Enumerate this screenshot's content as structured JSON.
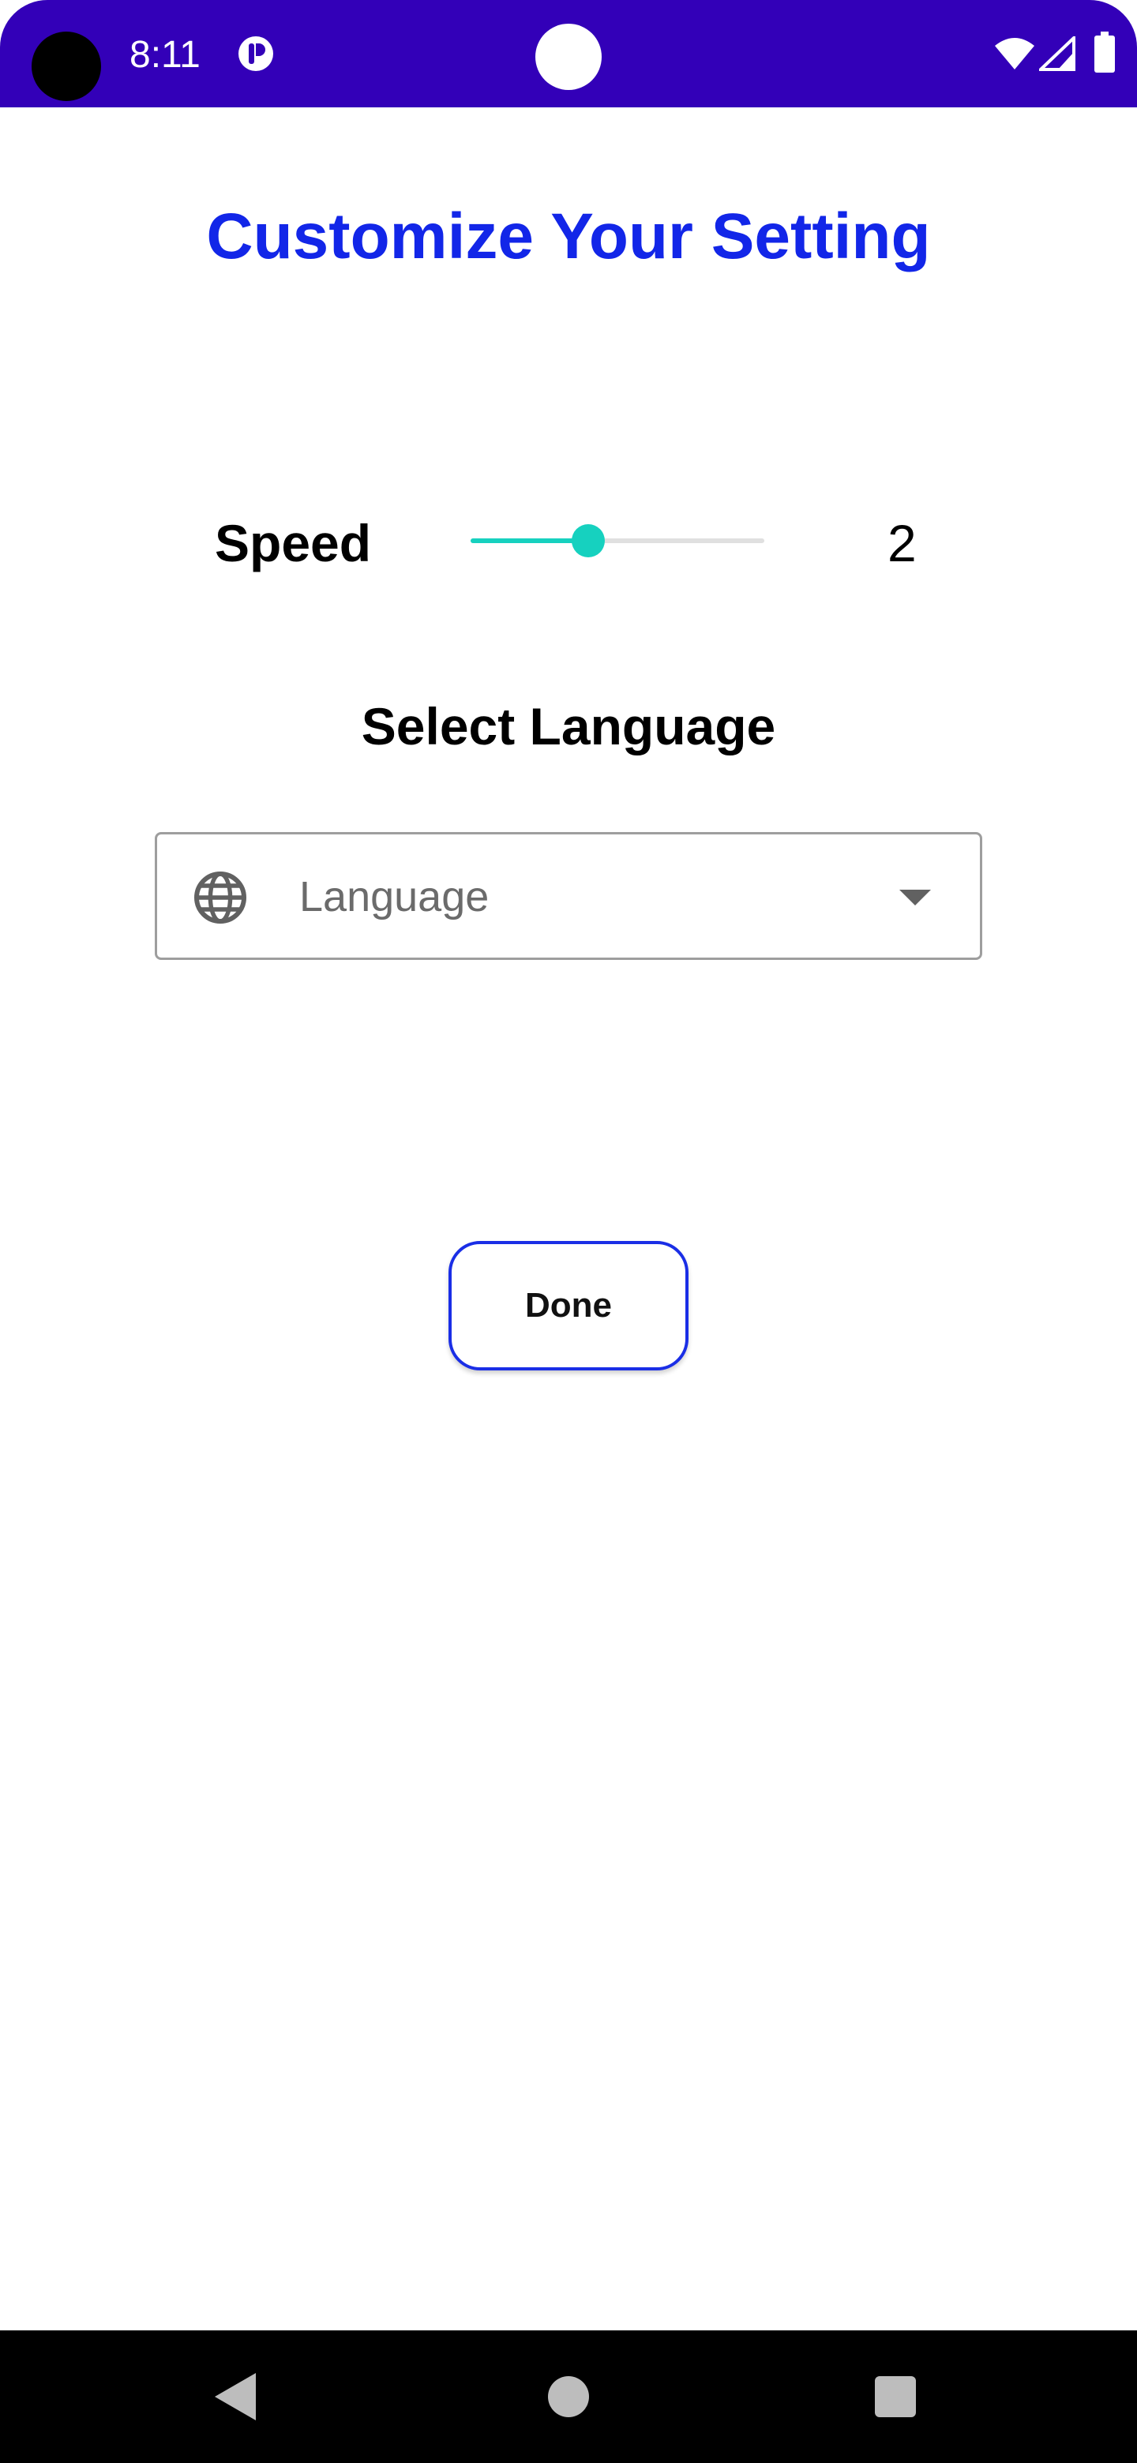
{
  "status_bar": {
    "time": "8:11",
    "background_color": "#3300b8",
    "icons": [
      "app-notification-icon",
      "wifi-icon",
      "signal-icon",
      "battery-icon"
    ]
  },
  "header": {
    "title": "Customize Your Setting",
    "title_color": "#1226e8"
  },
  "speed": {
    "label": "Speed",
    "value": "2",
    "slider_fraction": 0.4,
    "accent_color": "#16d1bf"
  },
  "language": {
    "heading": "Select Language",
    "placeholder": "Language",
    "icon": "globe-icon"
  },
  "actions": {
    "done_label": "Done"
  },
  "nav_bar": {
    "icons": [
      "back-icon",
      "home-icon",
      "recents-icon"
    ]
  }
}
